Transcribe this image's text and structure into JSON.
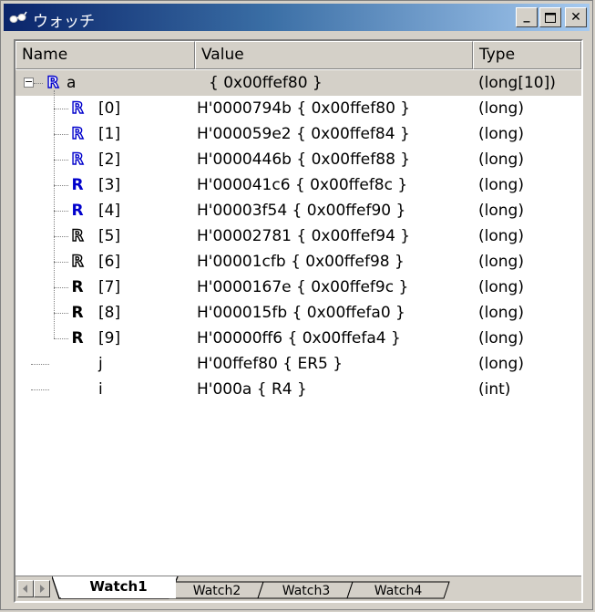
{
  "window": {
    "title": "ウォッチ",
    "icon": "watch-glasses-icon",
    "controls": {
      "minimize_label": "_",
      "maximize_icon": "maximize-icon",
      "close_label": "✕"
    }
  },
  "columns": {
    "name": "Name",
    "value": "Value",
    "type": "Type"
  },
  "rows": [
    {
      "name": "a",
      "value": "{ 0x00ffef80 }",
      "type": "(long[10])",
      "icon": "r-outline-blue",
      "selected": true
    },
    {
      "name": "[0]",
      "value": "H'0000794b { 0x00ffef80 }",
      "type": "(long)",
      "icon": "r-outline-blue"
    },
    {
      "name": "[1]",
      "value": "H'000059e2 { 0x00ffef84 }",
      "type": "(long)",
      "icon": "r-outline-blue"
    },
    {
      "name": "[2]",
      "value": "H'0000446b { 0x00ffef88 }",
      "type": "(long)",
      "icon": "r-outline-blue"
    },
    {
      "name": "[3]",
      "value": "H'000041c6 { 0x00ffef8c }",
      "type": "(long)",
      "icon": "r-solid-blue"
    },
    {
      "name": "[4]",
      "value": "H'00003f54 { 0x00ffef90 }",
      "type": "(long)",
      "icon": "r-solid-blue"
    },
    {
      "name": "[5]",
      "value": "H'00002781 { 0x00ffef94 }",
      "type": "(long)",
      "icon": "r-outline-black"
    },
    {
      "name": "[6]",
      "value": "H'00001cfb { 0x00ffef98 }",
      "type": "(long)",
      "icon": "r-outline-black"
    },
    {
      "name": "[7]",
      "value": "H'0000167e { 0x00ffef9c }",
      "type": "(long)",
      "icon": "r-solid-black"
    },
    {
      "name": "[8]",
      "value": "H'000015fb { 0x00ffefa0 }",
      "type": "(long)",
      "icon": "r-solid-black"
    },
    {
      "name": "[9]",
      "value": "H'00000ff6 { 0x00ffefa4 }",
      "type": "(long)",
      "icon": "r-solid-black"
    },
    {
      "name": "j",
      "value": "H'00ffef80 { ER5 }",
      "type": "(long)",
      "icon": ""
    },
    {
      "name": "i",
      "value": "H'000a { R4 }",
      "type": "(int)",
      "icon": ""
    }
  ],
  "badge_glyph": "R",
  "expander_glyph": "−",
  "tabs": [
    "Watch1",
    "Watch2",
    "Watch3",
    "Watch4"
  ],
  "active_tab": "Watch1",
  "scroll": {
    "left_icon": "scroll-left-icon",
    "right_icon": "scroll-right-icon"
  },
  "colors": {
    "titlebar_start": "#0a246a",
    "titlebar_end": "#a6caf0",
    "face": "#d4d0c8",
    "badge_blue": "#0000cc"
  }
}
